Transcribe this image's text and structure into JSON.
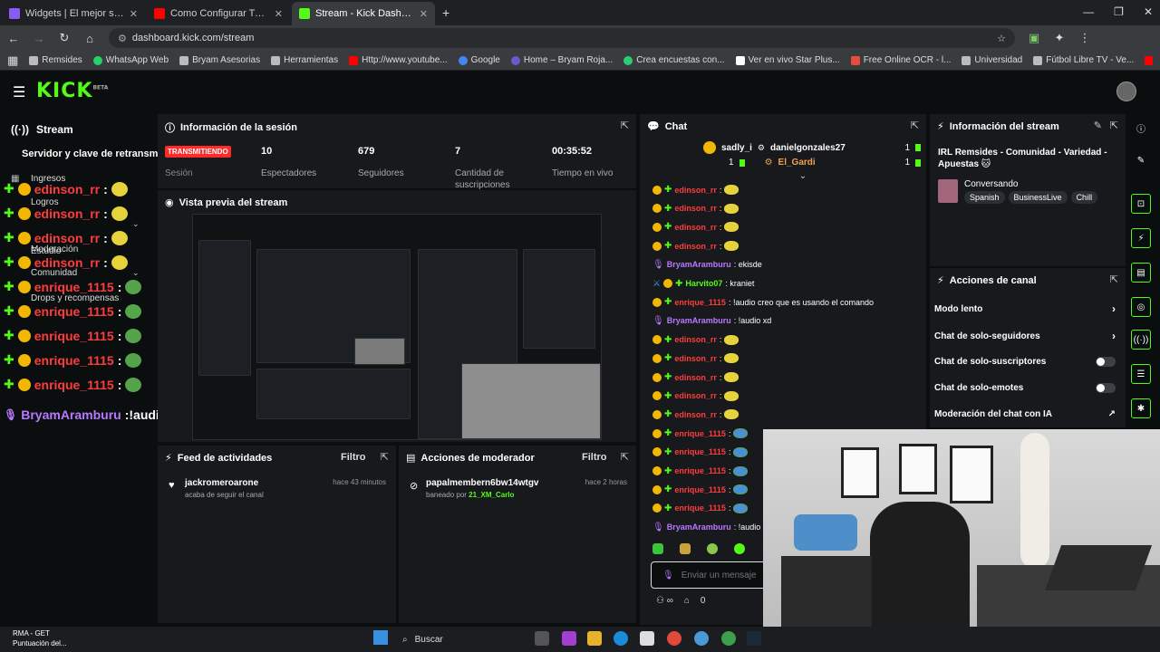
{
  "browser": {
    "tabs": [
      {
        "title": "Widgets | El mejor software pa",
        "color": "#8a5cf6"
      },
      {
        "title": "Como Configurar Tu Chat de V",
        "color": "#ff0000"
      },
      {
        "title": "Stream - Kick Dashboard",
        "color": "#53fc18"
      }
    ],
    "url": "dashboard.kick.com/stream",
    "bookmarks": [
      {
        "label": "Remsides",
        "color": "#bbbbbb"
      },
      {
        "label": "WhatsApp Web",
        "color": "#25d366"
      },
      {
        "label": "Bryam Asesorias",
        "color": "#bbbbbb"
      },
      {
        "label": "Herramientas",
        "color": "#bbbbbb"
      },
      {
        "label": "Http://www.youtube...",
        "color": "#ff0000"
      },
      {
        "label": "Google",
        "color": "#4285f4"
      },
      {
        "label": "Home – Bryam Roja...",
        "color": "#6a5acd"
      },
      {
        "label": "Crea encuestas con...",
        "color": "#2ecc71"
      },
      {
        "label": "Ver en vivo Star Plus...",
        "color": "#ffffff"
      },
      {
        "label": "Free Online OCR - l...",
        "color": "#e74c3c"
      },
      {
        "label": "Universidad",
        "color": "#bbbbbb"
      },
      {
        "label": "Fútbol Libre TV - Ve...",
        "color": "#bbbbbb"
      }
    ]
  },
  "header": {
    "logo": "KICK",
    "logo_sup": "BETA"
  },
  "sidebar": {
    "stream_label": "Stream",
    "server_label": "Servidor y clave de retransm",
    "items": [
      "Ingresos",
      "Logros",
      "Estudio",
      "Moderación",
      "Comunidad",
      "Drops y recompensas"
    ]
  },
  "overlay_chat": [
    {
      "name": "edinson_rr",
      "emote": "cheems"
    },
    {
      "name": "edinson_rr",
      "emote": "cheems"
    },
    {
      "name": "edinson_rr",
      "emote": "cheems"
    },
    {
      "name": "edinson_rr",
      "emote": "cheems"
    },
    {
      "name": "enrique_1115",
      "emote": "frog"
    },
    {
      "name": "enrique_1115",
      "emote": "frog"
    },
    {
      "name": "enrique_1115",
      "emote": "frog"
    },
    {
      "name": "enrique_1115",
      "emote": "frog"
    },
    {
      "name": "enrique_1115",
      "emote": "frog"
    }
  ],
  "overlay_last": {
    "name": "BryamAramburu",
    "msg": ":!audio que fue"
  },
  "session": {
    "title": "Información de la sesión",
    "live": "TRANSMITIENDO",
    "sesion": "Sesión",
    "stats": [
      {
        "value": "10",
        "label": "Espectadores"
      },
      {
        "value": "679",
        "label": "Seguidores"
      },
      {
        "value": "7",
        "label": "Cantidad de suscripciones"
      },
      {
        "value": "00:35:52",
        "label": "Tiempo en vivo"
      }
    ]
  },
  "preview": {
    "title": "Vista previa del stream"
  },
  "feed": {
    "title": "Feed de actividades",
    "filter": "Filtro",
    "name": "jackromeroarone",
    "sub": "acaba de seguir el canal",
    "ago": "hace 43 minutos"
  },
  "mod": {
    "title": "Acciones de moderador",
    "filter": "Filtro",
    "name": "papalmembern6bw14wtgv",
    "sub_prefix": "baneado por",
    "by": "21_XM_Carlo",
    "ago": "hace 2 horas"
  },
  "chat": {
    "title": "Chat",
    "pinned": [
      {
        "left": "sadly_i",
        "left_count": "1",
        "right": "danielgonzales27",
        "right_count": "1"
      },
      {
        "right": "El_Gardi",
        "right_count": "1"
      }
    ],
    "lines": [
      {
        "type": "emote",
        "name": "edinson_rr"
      },
      {
        "type": "emote",
        "name": "edinson_rr"
      },
      {
        "type": "emote",
        "name": "edinson_rr"
      },
      {
        "type": "emote",
        "name": "edinson_rr"
      },
      {
        "type": "text",
        "name": "BryamAramburu",
        "msg": ": ekisde",
        "color": "p"
      },
      {
        "type": "text",
        "name": "Harvito07",
        "msg": ": kraniet",
        "color": "g"
      },
      {
        "type": "text",
        "name": "enrique_1115",
        "msg": ": !audio creo que es usando el comando",
        "color": "r"
      },
      {
        "type": "text",
        "name": "BryamAramburu",
        "msg": ": !audio xd",
        "color": "p"
      },
      {
        "type": "emote",
        "name": "edinson_rr"
      },
      {
        "type": "emote",
        "name": "edinson_rr"
      },
      {
        "type": "emote",
        "name": "edinson_rr"
      },
      {
        "type": "emote",
        "name": "edinson_rr"
      },
      {
        "type": "emote",
        "name": "edinson_rr"
      },
      {
        "type": "frog",
        "name": "enrique_1115"
      },
      {
        "type": "frog",
        "name": "enrique_1115"
      },
      {
        "type": "frog",
        "name": "enrique_1115"
      },
      {
        "type": "frog",
        "name": "enrique_1115"
      },
      {
        "type": "frog",
        "name": "enrique_1115"
      },
      {
        "type": "text",
        "name": "BryamAramburu",
        "msg": ": !audio q",
        "color": "p"
      }
    ],
    "input_placeholder": "Enviar un mensaje",
    "bottom_count": "0"
  },
  "info": {
    "title": "Información del stream",
    "stream_title": "IRL Remsides - Comunidad - Variedad - Apuestas 🐱",
    "category": "Conversando",
    "tags": [
      "Spanish",
      "BusinessLive",
      "Chill"
    ]
  },
  "actions": {
    "title": "Acciones de canal",
    "items": [
      {
        "label": "Modo lento",
        "kind": "chevron"
      },
      {
        "label": "Chat de solo-seguidores",
        "kind": "chevron"
      },
      {
        "label": "Chat de solo-suscriptores",
        "kind": "toggle"
      },
      {
        "label": "Chat de solo-emotes",
        "kind": "toggle"
      },
      {
        "label": "Moderación del chat con IA",
        "kind": "external"
      }
    ]
  },
  "taskbar": {
    "weather_line1": "RMA - GET",
    "weather_line2": "Puntuación del...",
    "search": "Buscar"
  },
  "colors": {
    "kick_green": "#53fc18",
    "live_red": "#ff2a2a",
    "panel": "#17191c"
  }
}
